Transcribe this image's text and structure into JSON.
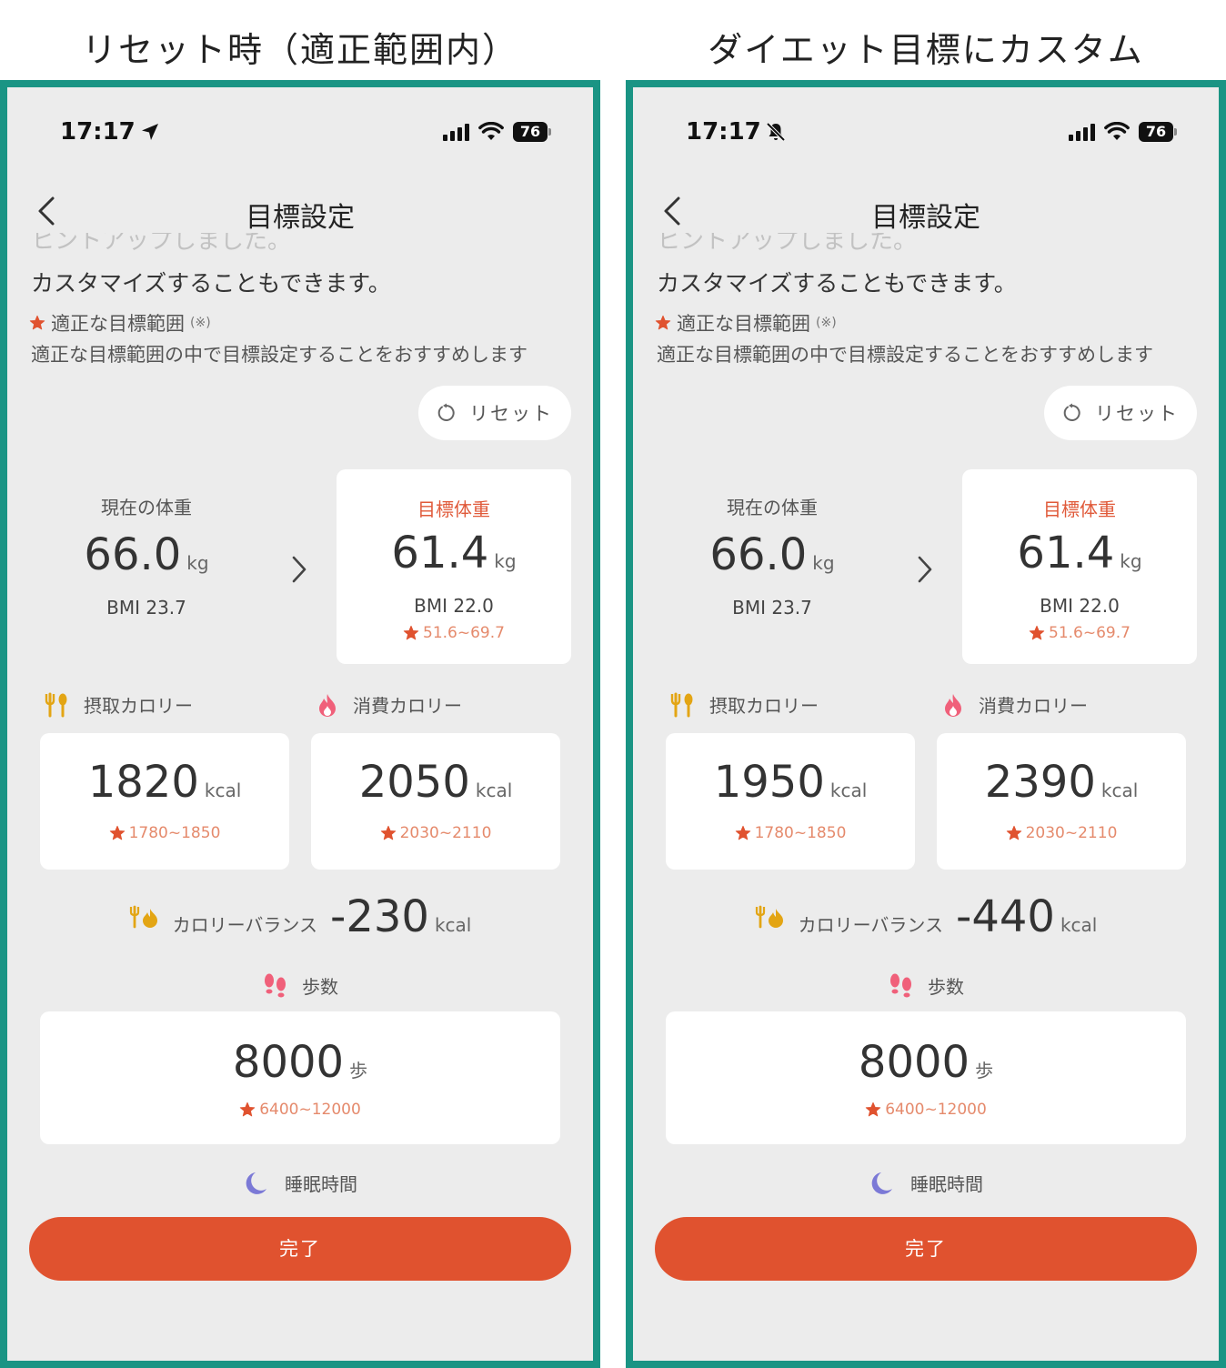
{
  "captions": {
    "left": "リセット時（適正範囲内）",
    "right": "ダイエット目標にカスタム"
  },
  "colors": {
    "accent": "#e0522f",
    "frame": "#1a9484",
    "background": "#ececec"
  },
  "panels": [
    {
      "status": {
        "time": "17:17",
        "indicator_icon": "location-arrow-icon",
        "battery": "76"
      },
      "title": "目標設定",
      "faded_text": "ヒントアップしました。",
      "description": "カスタマイズすることもできます。",
      "recommended_label": "適正な目標範囲",
      "recommended_note": "(※)",
      "recommended_sub": "適正な目標範囲の中で目標設定することをおすすめします",
      "reset_label": "リセット",
      "current_weight": {
        "label": "現在の体重",
        "value": "66.0",
        "unit": "kg",
        "bmi": "BMI 23.7"
      },
      "target_weight": {
        "label": "目標体重",
        "value": "61.4",
        "unit": "kg",
        "bmi": "BMI 22.0",
        "range": "51.6~69.7"
      },
      "intake": {
        "label": "摂取カロリー",
        "value": "1820",
        "unit": "kcal",
        "range": "1780~1850"
      },
      "burn": {
        "label": "消費カロリー",
        "value": "2050",
        "unit": "kcal",
        "range": "2030~2110"
      },
      "balance": {
        "label": "カロリーバランス",
        "value": "-230",
        "unit": "kcal"
      },
      "steps": {
        "label": "歩数",
        "value": "8000",
        "unit": "歩",
        "range": "6400~12000"
      },
      "sleep": {
        "label": "睡眠時間"
      },
      "done_label": "完了"
    },
    {
      "status": {
        "time": "17:17",
        "indicator_icon": "bell-slash-icon",
        "battery": "76"
      },
      "title": "目標設定",
      "faded_text": "ヒントアップしました。",
      "description": "カスタマイズすることもできます。",
      "recommended_label": "適正な目標範囲",
      "recommended_note": "(※)",
      "recommended_sub": "適正な目標範囲の中で目標設定することをおすすめします",
      "reset_label": "リセット",
      "current_weight": {
        "label": "現在の体重",
        "value": "66.0",
        "unit": "kg",
        "bmi": "BMI 23.7"
      },
      "target_weight": {
        "label": "目標体重",
        "value": "61.4",
        "unit": "kg",
        "bmi": "BMI 22.0",
        "range": "51.6~69.7"
      },
      "intake": {
        "label": "摂取カロリー",
        "value": "1950",
        "unit": "kcal",
        "range": "1780~1850"
      },
      "burn": {
        "label": "消費カロリー",
        "value": "2390",
        "unit": "kcal",
        "range": "2030~2110"
      },
      "balance": {
        "label": "カロリーバランス",
        "value": "-440",
        "unit": "kcal"
      },
      "steps": {
        "label": "歩数",
        "value": "8000",
        "unit": "歩",
        "range": "6400~12000"
      },
      "sleep": {
        "label": "睡眠時間"
      },
      "done_label": "完了"
    }
  ]
}
